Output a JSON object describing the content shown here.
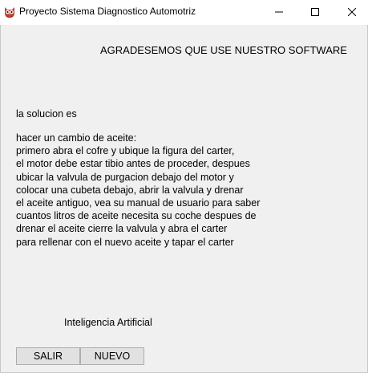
{
  "window": {
    "title": "Proyecto Sistema Diagnostico Automotriz"
  },
  "banner": "AGRADESEMOS QUE USE NUESTRO SOFTWARE",
  "solution": {
    "label": "la solucion es",
    "lines": [
      "hacer un cambio de aceite:",
      "primero abra el cofre y ubique la figura del carter,",
      "el motor debe estar tibio antes de proceder, despues",
      "ubicar la valvula de purgacion debajo del motor y",
      "colocar una cubeta debajo, abrir la valvula y drenar",
      "el aceite antiguo, vea su manual de usuario para saber",
      "cuantos litros de aceite necesita su coche despues de",
      "drenar el aceite cierre la valvula y abra el carter",
      "para rellenar con el nuevo aceite y tapar el carter"
    ]
  },
  "footer": {
    "label": "Inteligencia Artificial"
  },
  "buttons": {
    "exit": "SALIR",
    "new": "NUEVO"
  },
  "icons": {
    "app": "owl-app-icon",
    "minimize": "minimize-icon",
    "maximize": "maximize-icon",
    "close": "close-icon"
  }
}
